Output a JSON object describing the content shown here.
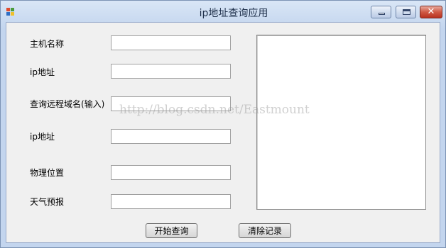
{
  "window": {
    "title": "ip地址查询应用",
    "controls": {
      "minimize": "",
      "maximize": "",
      "close": "✕"
    }
  },
  "form": {
    "fields": [
      {
        "label": "主机名称",
        "value": ""
      },
      {
        "label": "ip地址",
        "value": ""
      },
      {
        "label": "查询远程域名(输入)",
        "value": ""
      },
      {
        "label": "ip地址",
        "value": ""
      },
      {
        "label": "物理位置",
        "value": ""
      },
      {
        "label": "天气预报",
        "value": ""
      }
    ],
    "start_button": "开始查询",
    "clear_button": "清除记录"
  },
  "watermark": "http://blog.csdn.net/Eastmount",
  "colors": {
    "title_bar": "#c3d5ee",
    "client_bg": "#f0f0f0",
    "close_button": "#cf5a45"
  }
}
